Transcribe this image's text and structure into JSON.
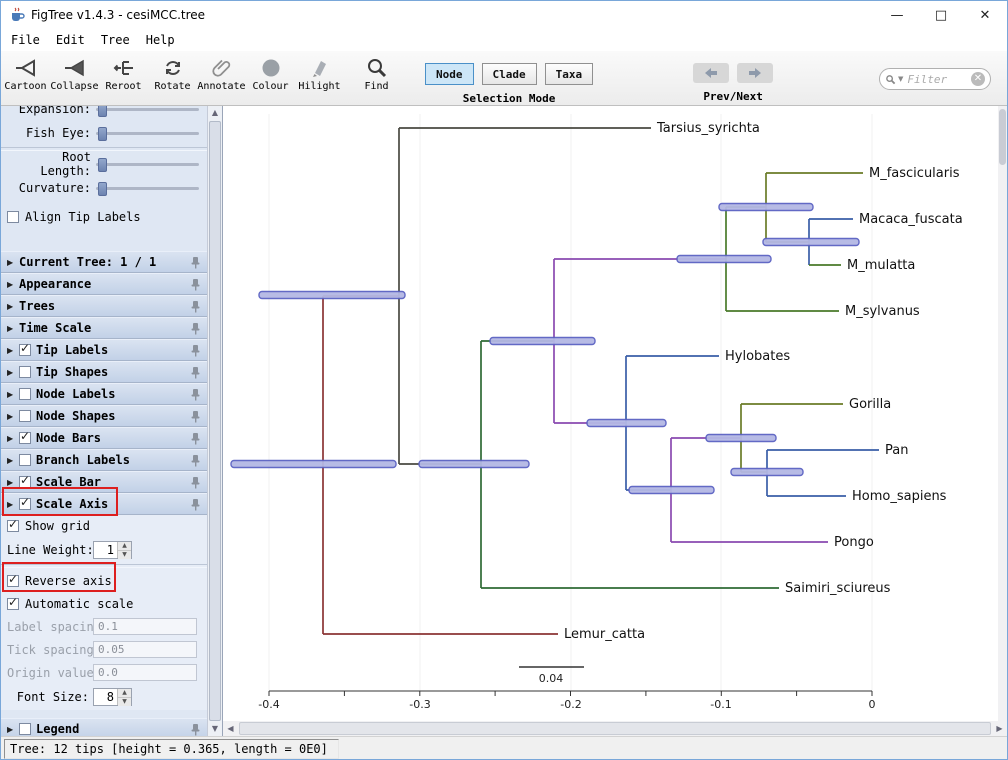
{
  "window": {
    "title": "FigTree v1.4.3 - cesiMCC.tree",
    "controls": {
      "minimize": "—",
      "maximize": "□",
      "close": "✕"
    }
  },
  "menu": {
    "items": [
      "File",
      "Edit",
      "Tree",
      "Help"
    ]
  },
  "toolbar": {
    "tools": [
      {
        "label": "Cartoon"
      },
      {
        "label": "Collapse"
      },
      {
        "label": "Reroot"
      },
      {
        "label": "Rotate"
      },
      {
        "label": "Annotate"
      },
      {
        "label": "Colour"
      },
      {
        "label": "Hilight"
      },
      {
        "label": "Find"
      }
    ],
    "selection": {
      "caption": "Selection Mode",
      "options": [
        "Node",
        "Clade",
        "Taxa"
      ],
      "selected": "Node"
    },
    "prevnext": {
      "caption": "Prev/Next"
    },
    "filter": {
      "placeholder": "Filter"
    }
  },
  "sidebar": {
    "sliders": {
      "expansion": "Expansion:",
      "fisheye": "Fish Eye:",
      "rootlength": "Root Length:",
      "curvature": "Curvature:"
    },
    "align_tip_labels": {
      "label": "Align Tip Labels",
      "checked": false
    },
    "sections": [
      {
        "label": "Current Tree: 1 / 1"
      },
      {
        "label": "Appearance"
      },
      {
        "label": "Trees"
      },
      {
        "label": "Time Scale"
      },
      {
        "label": "Tip Labels",
        "checked": true
      },
      {
        "label": "Tip Shapes",
        "checked": false
      },
      {
        "label": "Node Labels",
        "checked": false
      },
      {
        "label": "Node Shapes",
        "checked": false
      },
      {
        "label": "Node Bars",
        "checked": true
      },
      {
        "label": "Branch Labels",
        "checked": false
      },
      {
        "label": "Scale Bar",
        "checked": true
      },
      {
        "label": "Scale Axis",
        "checked": true
      }
    ],
    "scale_axis_panel": {
      "show_grid": {
        "label": "Show grid",
        "checked": true
      },
      "line_weight": {
        "label": "Line Weight:",
        "value": "1"
      },
      "reverse_axis": {
        "label": "Reverse axis",
        "checked": true
      },
      "automatic_scale": {
        "label": "Automatic scale",
        "checked": true
      },
      "label_spacing": {
        "label": "Label spacing:",
        "value": "0.1"
      },
      "tick_spacing": {
        "label": "Tick spacing:",
        "value": "0.05"
      },
      "origin_value": {
        "label": "Origin value:",
        "value": "0.0"
      },
      "font_size": {
        "label": "Font Size:",
        "value": "8"
      }
    },
    "legend": {
      "label": "Legend",
      "checked": false
    }
  },
  "tree": {
    "taxa": [
      "Tarsius_syrichta",
      "M_fascicularis",
      "Macaca_fuscata",
      "M_mulatta",
      "M_sylvanus",
      "Hylobates",
      "Gorilla",
      "Pan",
      "Homo_sapiens",
      "Pongo",
      "Saimiri_sciureus",
      "Lemur_catta"
    ],
    "axis_ticks": [
      "-0.4",
      "-0.3",
      "-0.2",
      "-0.1",
      "0"
    ],
    "scale_bar_label": "0.04",
    "node_bar_color": "#b4b8e4",
    "node_bar_border": "#5a61c2"
  },
  "status": {
    "text": "Tree: 12 tips [height = 0.365, length = 0E0]"
  }
}
